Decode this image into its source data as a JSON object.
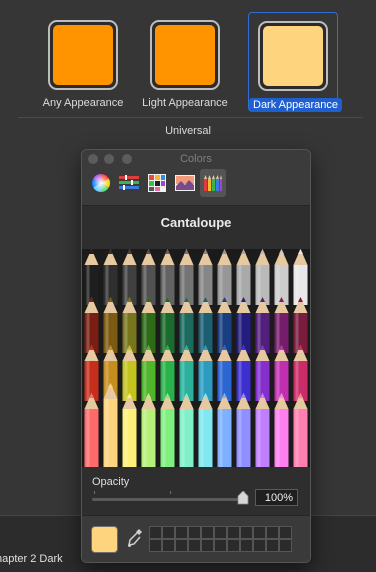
{
  "appearance": {
    "items": [
      {
        "label": "Any Appearance",
        "color": "#ff9300"
      },
      {
        "label": "Light Appearance",
        "color": "#ff9300"
      },
      {
        "label": "Dark Appearance",
        "color": "#ffd47f",
        "selected": true
      }
    ],
    "group_label": "Universal"
  },
  "document": {
    "tab_label": "hapter 2 Dark"
  },
  "colors_panel": {
    "title": "Colors",
    "toolbar": [
      "color-wheel-icon",
      "color-sliders-icon",
      "color-palettes-icon",
      "image-palettes-icon",
      "pencils-icon"
    ],
    "selected_tool": "pencils-icon",
    "selected_color_name": "Cantaloupe",
    "opacity_label": "Opacity",
    "opacity_value": "100%",
    "opacity_fraction": 1.0,
    "current_color": "#ffd47f",
    "swatch_wells": 22
  },
  "pencil_rows": [
    [
      "#1e1e1e",
      "#2f2f2f",
      "#404040",
      "#515151",
      "#636363",
      "#747474",
      "#868686",
      "#979797",
      "#a9a9a9",
      "#bababa",
      "#cccccc",
      "#e8e8e8"
    ],
    [
      "#781e12",
      "#7d5a12",
      "#77761d",
      "#2d6b18",
      "#1b6b2e",
      "#1d6b5f",
      "#1b5f73",
      "#1a3f80",
      "#241d7f",
      "#52207c",
      "#751d6b",
      "#7a1c3e"
    ],
    [
      "#c62d1c",
      "#c68d1f",
      "#c4c41f",
      "#4fb52a",
      "#29b24a",
      "#2bb09c",
      "#2b9cc0",
      "#2b66d1",
      "#3d2fd0",
      "#852fcd",
      "#c02fb0",
      "#c92c66"
    ],
    [
      "#ff6b6b",
      "#ffd47f",
      "#fff07a",
      "#b5f07a",
      "#7ff07f",
      "#7ff0c8",
      "#7fe8f0",
      "#7fb0ff",
      "#8f8fff",
      "#c07fff",
      "#ff7ff0",
      "#ff7fb0"
    ]
  ]
}
